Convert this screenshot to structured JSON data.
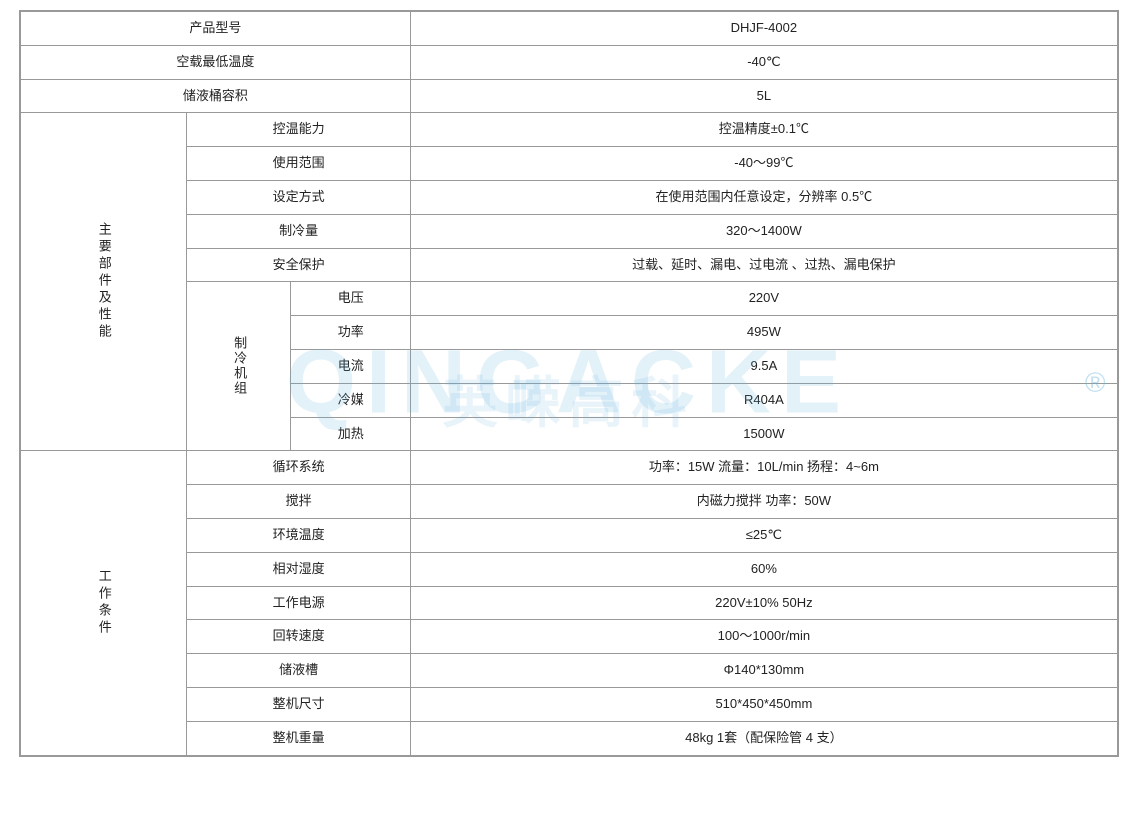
{
  "watermark": {
    "en": "QINGACKE",
    "cn": "英嵘高科"
  },
  "table": {
    "rows": [
      {
        "type": "simple",
        "label": "产品型号",
        "value": "DHJF-4002"
      },
      {
        "type": "simple",
        "label": "空载最低温度",
        "value": "-40℃"
      },
      {
        "type": "simple",
        "label": "储液桶容积",
        "value": "5L"
      }
    ],
    "main_section": {
      "label": "主要部件及性能",
      "sub_rows": [
        {
          "type": "plain",
          "label": "控温能力",
          "value": "控温精度±0.1℃"
        },
        {
          "type": "plain",
          "label": "使用范围",
          "value": "-40～99℃"
        },
        {
          "type": "plain",
          "label": "设定方式",
          "value": "在使用范围内任意设定，分辨率 0.5℃"
        },
        {
          "type": "plain",
          "label": "制冷量",
          "value": "320～1400W"
        },
        {
          "type": "plain",
          "label": "安全保护",
          "value": "过载、延时、漏电、过电流 、过热、漏电保护"
        }
      ],
      "sub_section": {
        "label": "制冷机组",
        "rows": [
          {
            "label": "电压",
            "value": "220V"
          },
          {
            "label": "功率",
            "value": "495W"
          },
          {
            "label": "电流",
            "value": "9.5A"
          },
          {
            "label": "冷媒",
            "value": "R404A"
          },
          {
            "label": "加热",
            "value": "1500W"
          }
        ]
      }
    },
    "work_section": {
      "label": "工作条件",
      "rows": [
        {
          "label": "循环系统",
          "value": "功率：15W   流量：10L/min   扬程：4~6m"
        },
        {
          "label": "搅拌",
          "value": "内磁力搅拌  功率：50W"
        },
        {
          "label": "环境温度",
          "value": "≤25℃"
        },
        {
          "label": "相对湿度",
          "value": "60%"
        },
        {
          "label": "工作电源",
          "value": "220V±10%   50Hz"
        },
        {
          "label": "回转速度",
          "value": "100～1000r/min"
        },
        {
          "label": "储液槽",
          "value": "Φ140*130mm"
        },
        {
          "label": "整机尺寸",
          "value": "510*450*450mm"
        },
        {
          "label": "整机重量",
          "value": "48kg   1套（配保险管 4 支）"
        }
      ]
    }
  }
}
